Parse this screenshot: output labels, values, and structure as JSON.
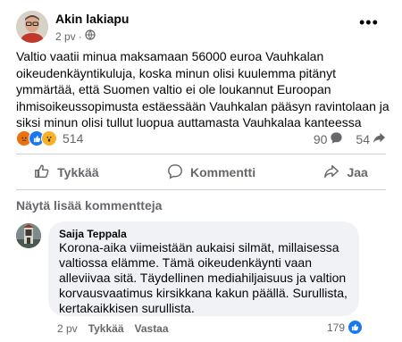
{
  "post": {
    "author": "Akin lakiapu",
    "time": "2 pv",
    "time_separator": "·",
    "body": "Valtio vaatii minua maksamaan 56000 euroa Vauhkalan oikeudenkäyntikuluja, koska minun olisi kuulemma pitänyt ymmärtää, että Suomen valtio ei ole loukannut Euroopan ihmisoikeussopimusta estäessään Vauhkalan pääsyn ravintolaan ja siksi minun olisi tullut luopua auttamasta Vauhkalaa kanteessa",
    "reaction_count": "514",
    "comment_count": "90",
    "share_count": "54"
  },
  "actions": {
    "like": "Tykkää",
    "comment": "Kommentti",
    "share": "Jaa"
  },
  "comments": {
    "more_label": "Näytä lisää kommentteja",
    "items": [
      {
        "name": "Saija Teppala",
        "text": "Korona-aika viimeistään aukaisi silmät, millaisessa valtiossa elämme. Tämä oikeudenkäynti vaan alleviivaa sitä. Täydellinen mediahiljaisuus ja valtion korvausvaatimus kirsikkana kakun päällä. Surullista, kertakaikkisen surullista.",
        "time": "2 pv",
        "like_label": "Tykkää",
        "reply_label": "Vastaa",
        "reaction_count": "179"
      }
    ]
  },
  "colors": {
    "accent": "#1877f2",
    "muted": "#65676b",
    "bubble": "#f0f2f5"
  }
}
